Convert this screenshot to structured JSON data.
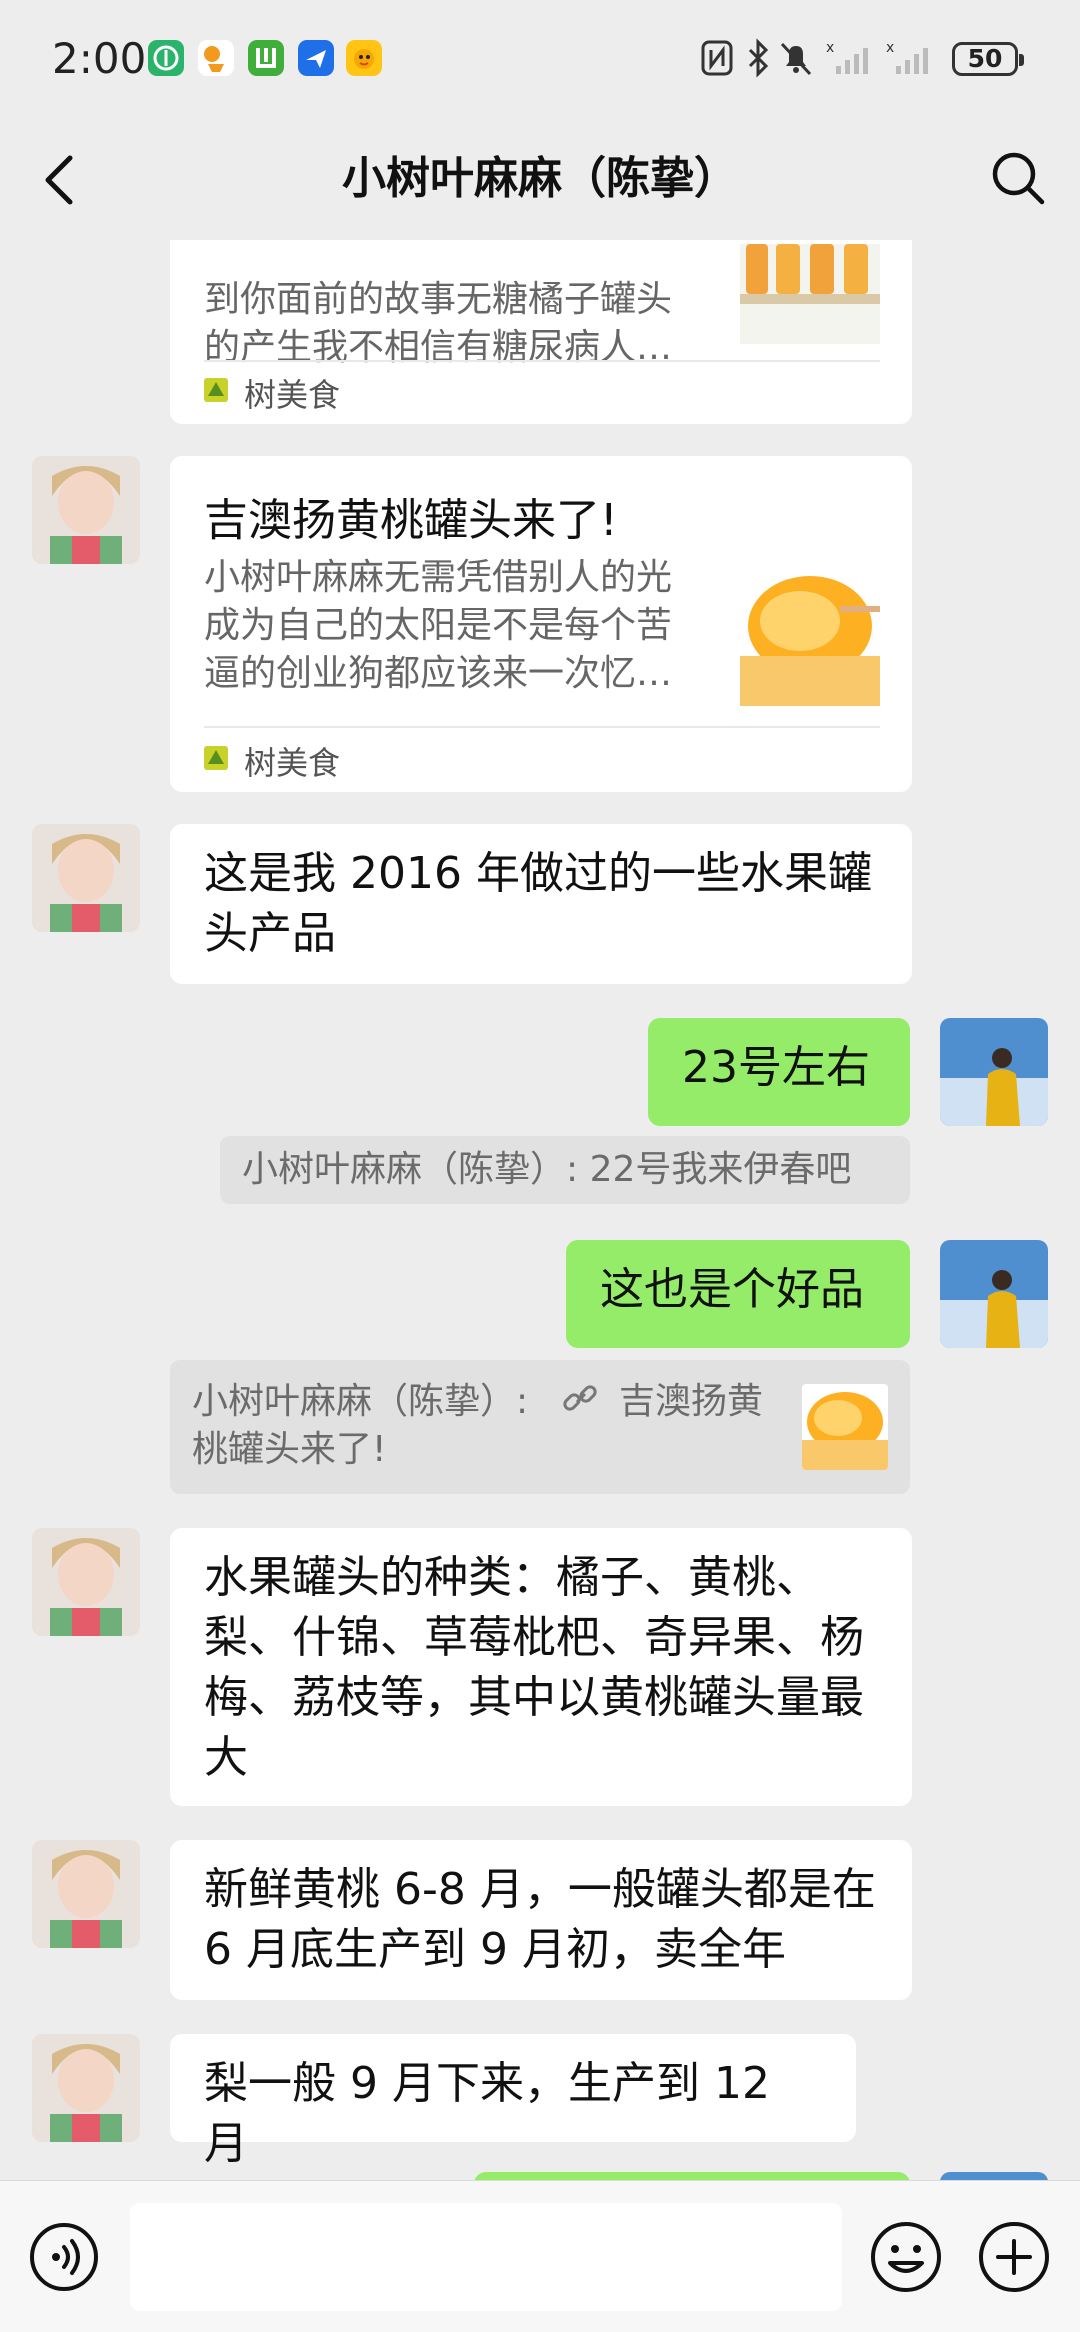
{
  "status_bar": {
    "time": "2:00",
    "battery": "50",
    "app_icons": [
      "green-leaf-app-icon",
      "orange-app-icon",
      "green-app-icon",
      "blue-plane-app-icon",
      "yellow-duck-app-icon"
    ],
    "system_icons": [
      "nfc-icon",
      "bluetooth-icon",
      "mute-bell-icon",
      "signal-icon",
      "signal-icon"
    ]
  },
  "header": {
    "title": "小树叶麻麻（陈挚）",
    "back_icon": "chevron-left-icon",
    "search_icon": "search-icon"
  },
  "messages": {
    "card1": {
      "desc_line1": "到你面前的故事无糖橘子罐头",
      "desc_line2": "的产生我不相信有糖尿病人…",
      "source": "树美食"
    },
    "card2": {
      "title": "吉澳扬黄桃罐头来了!",
      "desc_line1": "小树叶麻麻无需凭借别人的光",
      "desc_line2": "成为自己的太阳是不是每个苦",
      "desc_line3": "逼的创业狗都应该来一次忆…",
      "source": "树美食"
    },
    "msg3": {
      "line1": "这是我 2016 年做过的一些水果罐",
      "line2": "头产品"
    },
    "msg4": {
      "text": "23号左右"
    },
    "quote1": {
      "text": "小树叶麻麻（陈挚）:  22号我来伊春吧"
    },
    "msg5": {
      "text": "这也是个好品"
    },
    "quote2": {
      "line1_prefix": "小树叶麻麻（陈挚）:",
      "line1_link": "吉澳扬黄",
      "line2": "桃罐头来了!"
    },
    "msg6": {
      "line1": "水果罐头的种类：橘子、黄桃、",
      "line2": "梨、什锦、草莓枇杷、奇异果、杨",
      "line3": "梅、荔枝等，其中以黄桃罐头量最",
      "line4": "大"
    },
    "msg7": {
      "line1": "新鲜黄桃 6-8 月，一般罐头都是在",
      "line2": "6 月底生产到 9 月初，卖全年"
    },
    "msg8": {
      "text": "梨一般 9 月下来，生产到 12 月"
    }
  },
  "input_bar": {
    "placeholder": "",
    "voice_icon": "voice-icon",
    "emoji_icon": "emoji-icon",
    "plus_icon": "plus-icon"
  },
  "colors": {
    "background": "#EDEDED",
    "sent_bubble": "#95EC69",
    "received_bubble": "#FFFFFF",
    "quote_bg": "#E1E1E1"
  }
}
